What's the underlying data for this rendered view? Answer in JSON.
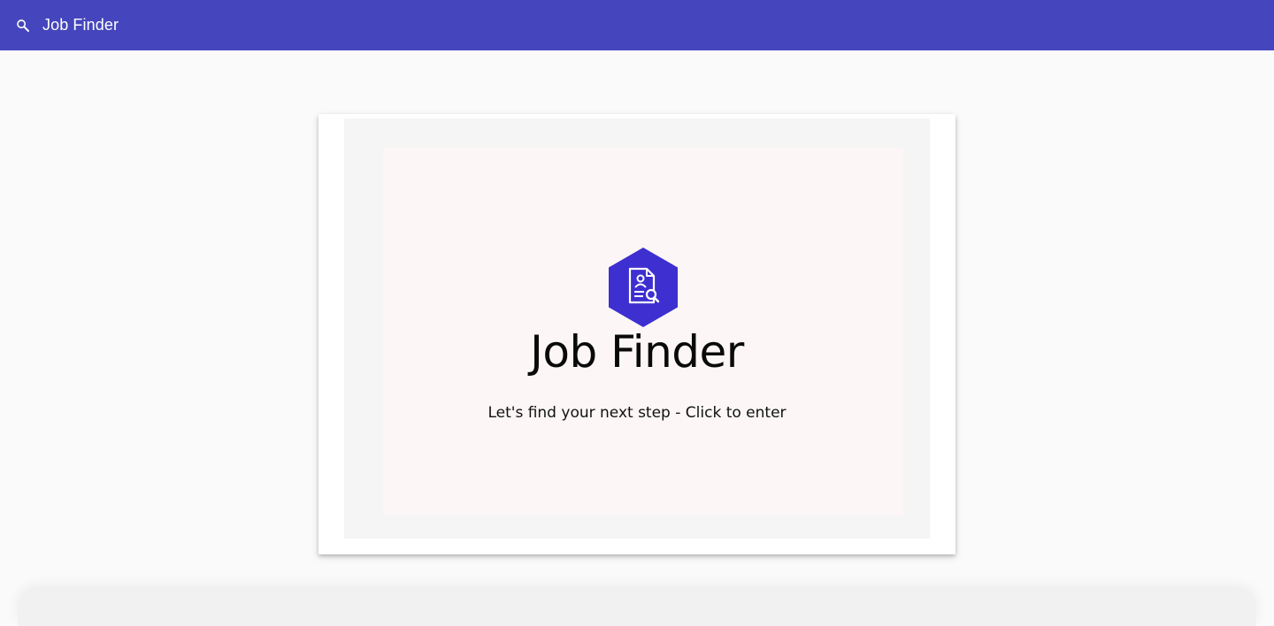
{
  "toolbar": {
    "search_icon": "search-icon",
    "title": "Job Finder",
    "background": "#4545bd"
  },
  "card": {
    "logo_icon": "job-search-document-icon",
    "logo_color": "#3d2fd0",
    "brand_name": "Job Finder",
    "tagline": "Let's find your next step - Click to enter"
  }
}
